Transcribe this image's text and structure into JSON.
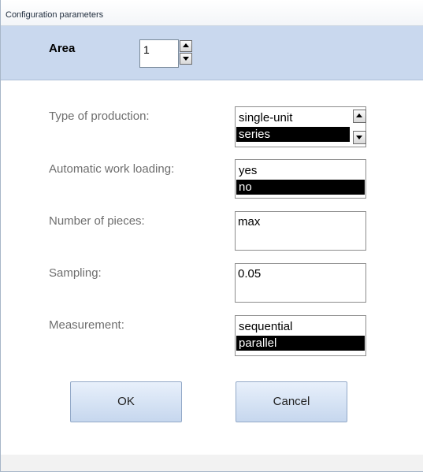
{
  "window": {
    "title": "Configuration parameters"
  },
  "area": {
    "label": "Area",
    "value": "1"
  },
  "fields": {
    "production": {
      "label": "Type of production:",
      "options": [
        "single-unit",
        "series"
      ],
      "selected": "series"
    },
    "work_loading": {
      "label": "Automatic work loading:",
      "options": [
        "yes",
        "no"
      ],
      "selected": "no"
    },
    "pieces": {
      "label": "Number of pieces:",
      "value": "max"
    },
    "sampling": {
      "label": "Sampling:",
      "value": "0.05"
    },
    "measurement": {
      "label": "Measurement:",
      "options": [
        "sequential",
        "parallel"
      ],
      "selected": "parallel"
    }
  },
  "buttons": {
    "ok": "OK",
    "cancel": "Cancel"
  },
  "colors": {
    "header_bg": "#c9d8ee",
    "button_bg": "#c6d7ee",
    "selection_bg": "#000000",
    "label_text": "#6e6e6e"
  }
}
